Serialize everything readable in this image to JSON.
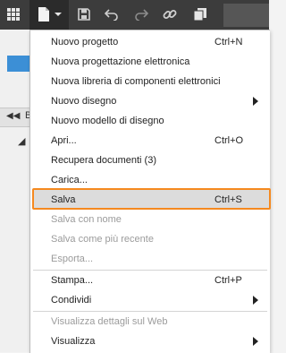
{
  "toolbar": {
    "icons": [
      "grid-icon",
      "new-document-icon",
      "chevron-down-icon",
      "save-icon",
      "undo-icon",
      "redo-icon",
      "link-icon",
      "copy-icon"
    ]
  },
  "background": {
    "b_label": "B"
  },
  "menu": {
    "items": [
      {
        "label": "Nuovo progetto",
        "shortcut": "Ctrl+N",
        "enabled": true
      },
      {
        "label": "Nuova progettazione elettronica",
        "shortcut": "",
        "enabled": true
      },
      {
        "label": "Nuova libreria di componenti elettronici",
        "shortcut": "",
        "enabled": true
      },
      {
        "label": "Nuovo disegno",
        "shortcut": "",
        "enabled": true,
        "submenu": true
      },
      {
        "label": "Nuovo modello di disegno",
        "shortcut": "",
        "enabled": true
      },
      {
        "label": "Apri...",
        "shortcut": "Ctrl+O",
        "enabled": true
      },
      {
        "label": "Recupera documenti (3)",
        "shortcut": "",
        "enabled": true
      },
      {
        "label": "Carica...",
        "shortcut": "",
        "enabled": true
      },
      {
        "label": "Salva",
        "shortcut": "Ctrl+S",
        "enabled": true,
        "highlighted": true
      },
      {
        "label": "Salva con nome",
        "shortcut": "",
        "enabled": false
      },
      {
        "label": "Salva come più recente",
        "shortcut": "",
        "enabled": false
      },
      {
        "label": "Esporta...",
        "shortcut": "",
        "enabled": false
      },
      {
        "label": "Stampa...",
        "shortcut": "Ctrl+P",
        "enabled": true
      },
      {
        "label": "Condividi",
        "shortcut": "",
        "enabled": true,
        "submenu": true
      },
      {
        "label": "Visualizza dettagli sul Web",
        "shortcut": "",
        "enabled": false
      },
      {
        "label": "Visualizza",
        "shortcut": "",
        "enabled": true,
        "submenu": true
      }
    ],
    "highlight_color": "#f5891f"
  }
}
